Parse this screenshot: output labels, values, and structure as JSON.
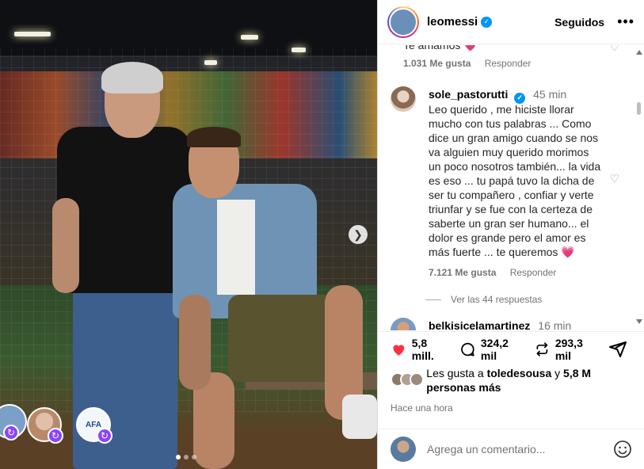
{
  "post": {
    "carousel_dots": 3,
    "active_dot": 0,
    "next_button_icon": "chevron-right-icon"
  },
  "header": {
    "username": "leomessi",
    "verified": true,
    "follow_label": "Seguidos",
    "more_icon": "more-horizontal-icon"
  },
  "previous_comment": {
    "partial_text": "Te amamos 💗",
    "likes": "1.031 Me gusta",
    "reply_label": "Responder"
  },
  "comment": {
    "username": "sole_pastorutti",
    "verified": true,
    "time": "45 min",
    "text": "Leo querido , me hiciste llorar mucho con tus palabras ... Como dice un gran amigo cuando se nos va alguien muy querido morimos un poco nosotros también... la vida es eso ... tu papá tuvo la dicha de ser tu compañero , confiar y verte triunfar y se fue con la certeza de saberte un gran ser humano... el dolor es grande pero el amor es más fuerte ... te queremos 💗",
    "likes": "7.121 Me gusta",
    "reply_label": "Responder",
    "view_replies": "Ver las 44 respuestas"
  },
  "next_comment": {
    "username": "belkisicelamartinez",
    "time": "16 min"
  },
  "actions": {
    "likes_count": "5,8 mill.",
    "comments_count": "324,2 mil",
    "reposts_count": "293,3 mil",
    "like_color": "#ff3040"
  },
  "liked_by": {
    "prefix": "Les gusta a",
    "user": "toledesousa",
    "conjunction": "y",
    "others": "5,8 M personas más"
  },
  "timestamp": "Hace una hora",
  "composer": {
    "placeholder": "Agrega un comentario..."
  }
}
